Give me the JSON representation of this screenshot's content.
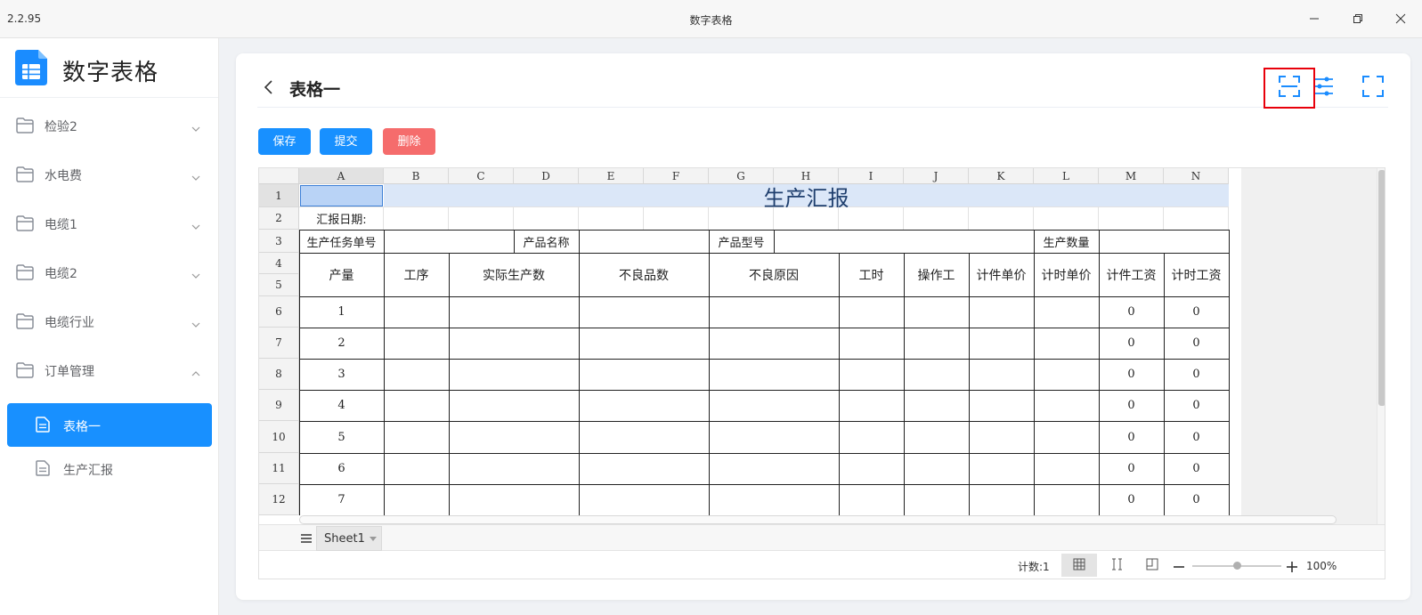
{
  "window": {
    "version": "2.2.95",
    "title": "数字表格"
  },
  "sidebar": {
    "brand": "数字表格",
    "groups": [
      {
        "label": "检验2",
        "expanded": false
      },
      {
        "label": "水电费",
        "expanded": false
      },
      {
        "label": "电缆1",
        "expanded": false
      },
      {
        "label": "电缆2",
        "expanded": false
      },
      {
        "label": "电缆行业",
        "expanded": false
      },
      {
        "label": "订单管理",
        "expanded": true
      }
    ],
    "sub_items": [
      {
        "label": "表格一",
        "active": true
      },
      {
        "label": "生产汇报",
        "active": false
      }
    ]
  },
  "header": {
    "title": "表格一"
  },
  "toolbar": {
    "save": "保存",
    "submit": "提交",
    "delete": "删除",
    "colors": {
      "primary": "#1890ff",
      "danger": "#f56c6c"
    }
  },
  "spreadsheet": {
    "columns": [
      "A",
      "B",
      "C",
      "D",
      "E",
      "F",
      "G",
      "H",
      "I",
      "J",
      "K",
      "L",
      "M",
      "N"
    ],
    "rows": [
      "1",
      "2",
      "3",
      "4",
      "5",
      "6",
      "7",
      "8",
      "9",
      "10",
      "11",
      "12"
    ],
    "title": "生产汇报",
    "report_date_label": "汇报日期:",
    "row3": {
      "task_no": "生产任务单号",
      "product_name": "产品名称",
      "product_model": "产品型号",
      "quantity": "生产数量"
    },
    "headers": [
      "产量",
      "工序",
      "实际生产数",
      "不良品数",
      "不良原因",
      "工时",
      "操作工",
      "计件单价",
      "计时单价",
      "计件工资",
      "计时工资"
    ],
    "data_rows": [
      {
        "no": "1",
        "piece_wage": "0",
        "time_wage": "0"
      },
      {
        "no": "2",
        "piece_wage": "0",
        "time_wage": "0"
      },
      {
        "no": "3",
        "piece_wage": "0",
        "time_wage": "0"
      },
      {
        "no": "4",
        "piece_wage": "0",
        "time_wage": "0"
      },
      {
        "no": "5",
        "piece_wage": "0",
        "time_wage": "0"
      },
      {
        "no": "6",
        "piece_wage": "0",
        "time_wage": "0"
      },
      {
        "no": "7",
        "piece_wage": "0",
        "time_wage": "0"
      }
    ],
    "sheet_tab": "Sheet1",
    "status_count": "计数:1",
    "zoom": "100%"
  }
}
